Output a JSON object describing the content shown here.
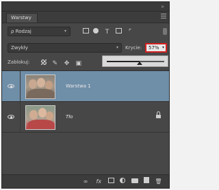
{
  "panel": {
    "title": "Warstwy"
  },
  "filter": {
    "kind_label": "ρ Rodzaj",
    "icons": [
      "image-filter-icon",
      "adjustment-filter-icon",
      "type-filter-icon",
      "shape-filter-icon",
      "smart-object-filter-icon"
    ]
  },
  "blend": {
    "mode": "Zwykły",
    "opacity_label": "Krycie:",
    "opacity_value": "57%",
    "opacity_fraction": 0.57
  },
  "lock": {
    "label": "Zablokuj:",
    "icons": [
      "lock-transparent-icon",
      "lock-image-icon",
      "lock-position-icon",
      "lock-all-icon"
    ]
  },
  "layers": [
    {
      "name": "Warstwa 1",
      "selected": true,
      "visible": true,
      "locked": false
    },
    {
      "name": "Tło",
      "selected": false,
      "visible": true,
      "locked": true
    }
  ],
  "bottom_tools": {
    "link": "∞",
    "fx": "fx"
  },
  "colors": {
    "panel_bg": "#474747",
    "selected_layer": "#6f8ea8",
    "opacity_highlight": "#d32020"
  }
}
